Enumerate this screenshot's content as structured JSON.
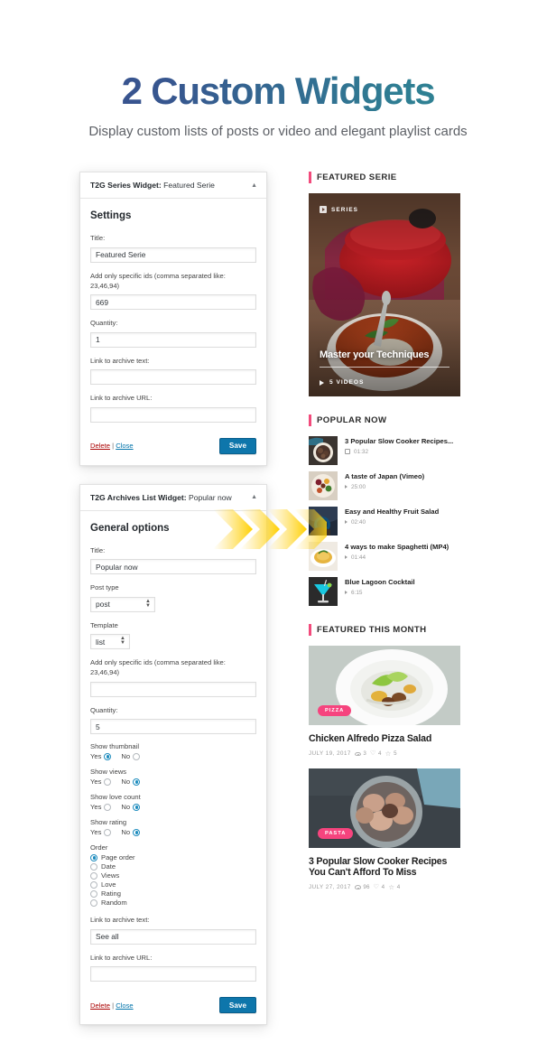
{
  "hero": {
    "title": "2 Custom Widgets",
    "subtitle": "Display custom lists of posts or video and elegant playlist cards",
    "gradient_from": "#3b4f8e",
    "gradient_to": "#2f8b93"
  },
  "widgets": [
    {
      "header_prefix": "T2G Series Widget:",
      "header_title": "Featured Serie",
      "collapse_icon": "chevron-up-icon",
      "section_title": "Settings",
      "fields": [
        {
          "label": "Title:",
          "value": "Featured Serie",
          "type": "text"
        },
        {
          "label": "Add only specific ids (comma separated like: 23,46,94)",
          "value": "669",
          "type": "text"
        },
        {
          "label": "Quantity:",
          "value": "1",
          "type": "text"
        },
        {
          "label": "Link to archive text:",
          "value": "",
          "type": "text"
        },
        {
          "label": "Link to archive URL:",
          "value": "",
          "type": "text"
        }
      ],
      "delete_label": "Delete",
      "separator": "|",
      "close_label": "Close",
      "save_label": "Save"
    },
    {
      "header_prefix": "T2G Archives List Widget:",
      "header_title": "Popular now",
      "collapse_icon": "chevron-up-icon",
      "section_title": "General options",
      "title_label": "Title:",
      "title_value": "Popular now",
      "post_type_label": "Post type",
      "post_type_value": "post",
      "template_label": "Template",
      "template_value": "list",
      "ids_label": "Add only specific ids (comma separated like: 23,46,94)",
      "ids_value": "",
      "quantity_label": "Quantity:",
      "quantity_value": "5",
      "yes_label": "Yes",
      "no_label": "No",
      "toggles": [
        {
          "label": "Show thumbnail",
          "selected": "yes"
        },
        {
          "label": "Show views",
          "selected": "no"
        },
        {
          "label": "Show love count",
          "selected": "no"
        },
        {
          "label": "Show rating",
          "selected": "no"
        }
      ],
      "order_label": "Order",
      "order_options": [
        {
          "label": "Page order",
          "selected": true
        },
        {
          "label": "Date",
          "selected": false
        },
        {
          "label": "Views",
          "selected": false
        },
        {
          "label": "Love",
          "selected": false
        },
        {
          "label": "Rating",
          "selected": false
        },
        {
          "label": "Random",
          "selected": false
        }
      ],
      "archive_text_label": "Link to archive text:",
      "archive_text_value": "See all",
      "archive_url_label": "Link to archive URL:",
      "archive_url_value": "",
      "delete_label": "Delete",
      "separator": "|",
      "close_label": "Close",
      "save_label": "Save"
    }
  ],
  "preview": {
    "accent_color": "#f24b7c",
    "featured_serie": {
      "heading": "FEATURED SERIE",
      "badge_label": "SERIES",
      "badge_icon": "video-icon",
      "card_title": "Master your Techniques",
      "video_count": "5 VIDEOS",
      "play_icon": "play-icon"
    },
    "popular_now": {
      "heading": "POPULAR NOW",
      "items": [
        {
          "title": "3 Popular Slow Cooker Recipes...",
          "duration": "01:32",
          "icon": "film-icon"
        },
        {
          "title": "A taste of Japan (Vimeo)",
          "duration": "25:00",
          "icon": "play-icon"
        },
        {
          "title": "Easy and Healthy Fruit Salad",
          "duration": "02:40",
          "icon": "play-icon"
        },
        {
          "title": "4 ways to make Spaghetti (MP4)",
          "duration": "01:44",
          "icon": "play-icon"
        },
        {
          "title": "Blue Lagoon Cocktail",
          "duration": "6:15",
          "icon": "play-icon"
        }
      ]
    },
    "featured_this_month": {
      "heading": "FEATURED THIS MONTH",
      "posts": [
        {
          "tag": "PIZZA",
          "title": "Chicken Alfredo Pizza Salad",
          "date": "JULY 19, 2017",
          "views": "3",
          "loves": "4",
          "rating": "5"
        },
        {
          "tag": "PASTA",
          "title": "3 Popular Slow Cooker Recipes You Can't Afford To Miss",
          "date": "JULY 27, 2017",
          "views": "96",
          "loves": "4",
          "rating": "4"
        }
      ]
    }
  }
}
